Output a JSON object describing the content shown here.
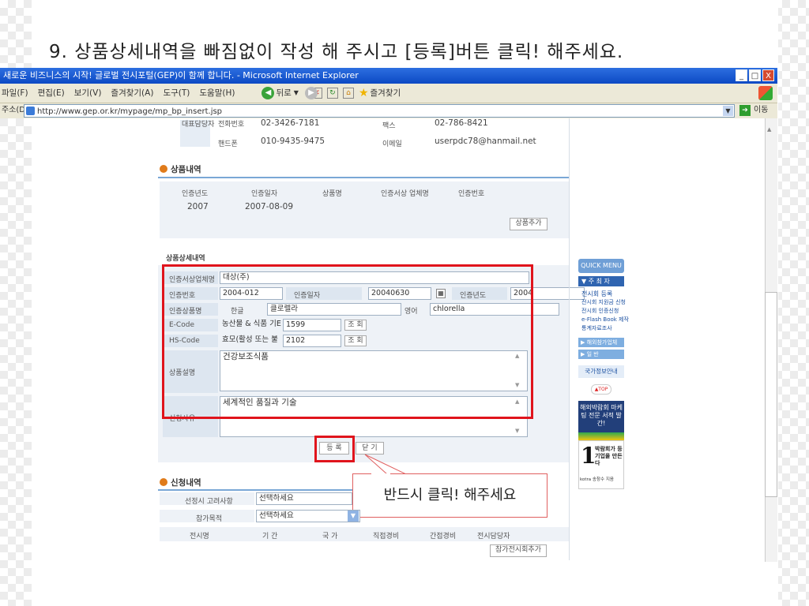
{
  "instruction": "9. 상품상세내역을 빠짐없이 작성 해 주시고 [등록]버튼 클릭! 해주세요.",
  "window": {
    "title": "새로운 비즈니스의 시작! 글로벌 전시포털(GEP)이 함께 합니다. - Microsoft Internet Explorer",
    "min": "_",
    "max": "□",
    "close": "X"
  },
  "menu": [
    "파일(F)",
    "편집(E)",
    "보기(V)",
    "즐겨찾기(A)",
    "도구(T)",
    "도움말(H)"
  ],
  "toolbar": {
    "back": "뒤로",
    "favorites": "즐겨찾기"
  },
  "address": {
    "label": "주소(D)",
    "url": "http://www.gep.or.kr/mypage/mp_bp_insert.jsp",
    "go": "이동"
  },
  "contact": {
    "phone_label": "전화번호",
    "phone": "02-3426-7181",
    "mobile_label": "핸드폰",
    "mobile": "010-9435-9475",
    "fax_label": "팩스",
    "fax": "02-786-8421",
    "email_label": "이메일",
    "email": "userpdc78@hanmail.net",
    "rep_label": "대표담당자"
  },
  "products": {
    "title": "상품내역",
    "headers": [
      "인증년도",
      "인증일자",
      "상품명",
      "인증서상 업체명",
      "인증번호"
    ],
    "row": {
      "year": "2007",
      "date": "2007-08-09"
    },
    "add": "상품추가"
  },
  "detail": {
    "title": "상품상세내역",
    "company_label": "인증서상업체명",
    "company": "대상(주)",
    "certno_label": "인증번호",
    "certno": "2004-012",
    "certdate_label": "인증일자",
    "certdate": "20040630",
    "certyear_label": "인증년도",
    "certyear": "2004",
    "prod_label": "인증상품명",
    "kor_label": "한글",
    "kor": "클로렐라",
    "eng_label": "영어",
    "eng": "chlorella",
    "ecode_label": "E-Code",
    "ecode_name": "농산물 & 식품 기E",
    "ecode": "1599",
    "hscode_label": "HS-Code",
    "hscode_name": "효모(활성 또는 불",
    "hscode": "2102",
    "lookup": "조 회",
    "desc_label": "상품설명",
    "desc": "건강보조식품",
    "apply_label": "신청사유",
    "apply": "세계적인 품질과 기술",
    "register": "등 록",
    "cancel": "닫 기"
  },
  "callout": "반드시 클릭! 해주세요",
  "application": {
    "title": "신청내역",
    "consider_label": "선정시 고려사항",
    "consider": "선택하세요",
    "purpose_label": "참가목적",
    "purpose": "선택하세요",
    "headers": [
      "전시명",
      "기 간",
      "국 가",
      "직접경비",
      "간접경비",
      "전시담당자"
    ],
    "add": "참가전시회추가"
  },
  "sidebar": {
    "quick": "QUICK MENU",
    "main": "▼ 주 최 자",
    "items": [
      "전시회 등록",
      "전시회 지원금 신청",
      "전시회 인증신청",
      "e-Flash Book 제작",
      "통계자료조사"
    ],
    "overseas": "▶ 해외참가업체",
    "general": "▶ 일 반",
    "info": "국가정보안내",
    "top": "▲TOP",
    "banner1": "해외박람회 마케팅 전문 서적 발간!",
    "banner2_num": "1",
    "banner2": "박람회가 등기업을 만든다",
    "banner2_by": "kotra 송창수 지음"
  }
}
